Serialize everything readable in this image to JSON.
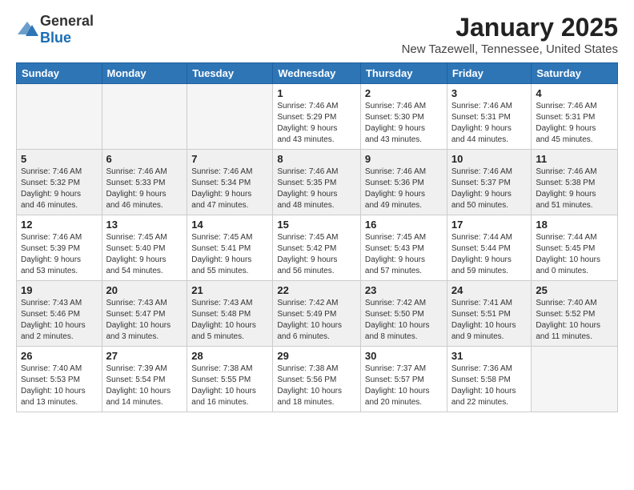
{
  "logo": {
    "general": "General",
    "blue": "Blue"
  },
  "title": "January 2025",
  "location": "New Tazewell, Tennessee, United States",
  "headers": [
    "Sunday",
    "Monday",
    "Tuesday",
    "Wednesday",
    "Thursday",
    "Friday",
    "Saturday"
  ],
  "weeks": [
    [
      {
        "day": "",
        "info": ""
      },
      {
        "day": "",
        "info": ""
      },
      {
        "day": "",
        "info": ""
      },
      {
        "day": "1",
        "info": "Sunrise: 7:46 AM\nSunset: 5:29 PM\nDaylight: 9 hours\nand 43 minutes."
      },
      {
        "day": "2",
        "info": "Sunrise: 7:46 AM\nSunset: 5:30 PM\nDaylight: 9 hours\nand 43 minutes."
      },
      {
        "day": "3",
        "info": "Sunrise: 7:46 AM\nSunset: 5:31 PM\nDaylight: 9 hours\nand 44 minutes."
      },
      {
        "day": "4",
        "info": "Sunrise: 7:46 AM\nSunset: 5:31 PM\nDaylight: 9 hours\nand 45 minutes."
      }
    ],
    [
      {
        "day": "5",
        "info": "Sunrise: 7:46 AM\nSunset: 5:32 PM\nDaylight: 9 hours\nand 46 minutes."
      },
      {
        "day": "6",
        "info": "Sunrise: 7:46 AM\nSunset: 5:33 PM\nDaylight: 9 hours\nand 46 minutes."
      },
      {
        "day": "7",
        "info": "Sunrise: 7:46 AM\nSunset: 5:34 PM\nDaylight: 9 hours\nand 47 minutes."
      },
      {
        "day": "8",
        "info": "Sunrise: 7:46 AM\nSunset: 5:35 PM\nDaylight: 9 hours\nand 48 minutes."
      },
      {
        "day": "9",
        "info": "Sunrise: 7:46 AM\nSunset: 5:36 PM\nDaylight: 9 hours\nand 49 minutes."
      },
      {
        "day": "10",
        "info": "Sunrise: 7:46 AM\nSunset: 5:37 PM\nDaylight: 9 hours\nand 50 minutes."
      },
      {
        "day": "11",
        "info": "Sunrise: 7:46 AM\nSunset: 5:38 PM\nDaylight: 9 hours\nand 51 minutes."
      }
    ],
    [
      {
        "day": "12",
        "info": "Sunrise: 7:46 AM\nSunset: 5:39 PM\nDaylight: 9 hours\nand 53 minutes."
      },
      {
        "day": "13",
        "info": "Sunrise: 7:45 AM\nSunset: 5:40 PM\nDaylight: 9 hours\nand 54 minutes."
      },
      {
        "day": "14",
        "info": "Sunrise: 7:45 AM\nSunset: 5:41 PM\nDaylight: 9 hours\nand 55 minutes."
      },
      {
        "day": "15",
        "info": "Sunrise: 7:45 AM\nSunset: 5:42 PM\nDaylight: 9 hours\nand 56 minutes."
      },
      {
        "day": "16",
        "info": "Sunrise: 7:45 AM\nSunset: 5:43 PM\nDaylight: 9 hours\nand 57 minutes."
      },
      {
        "day": "17",
        "info": "Sunrise: 7:44 AM\nSunset: 5:44 PM\nDaylight: 9 hours\nand 59 minutes."
      },
      {
        "day": "18",
        "info": "Sunrise: 7:44 AM\nSunset: 5:45 PM\nDaylight: 10 hours\nand 0 minutes."
      }
    ],
    [
      {
        "day": "19",
        "info": "Sunrise: 7:43 AM\nSunset: 5:46 PM\nDaylight: 10 hours\nand 2 minutes."
      },
      {
        "day": "20",
        "info": "Sunrise: 7:43 AM\nSunset: 5:47 PM\nDaylight: 10 hours\nand 3 minutes."
      },
      {
        "day": "21",
        "info": "Sunrise: 7:43 AM\nSunset: 5:48 PM\nDaylight: 10 hours\nand 5 minutes."
      },
      {
        "day": "22",
        "info": "Sunrise: 7:42 AM\nSunset: 5:49 PM\nDaylight: 10 hours\nand 6 minutes."
      },
      {
        "day": "23",
        "info": "Sunrise: 7:42 AM\nSunset: 5:50 PM\nDaylight: 10 hours\nand 8 minutes."
      },
      {
        "day": "24",
        "info": "Sunrise: 7:41 AM\nSunset: 5:51 PM\nDaylight: 10 hours\nand 9 minutes."
      },
      {
        "day": "25",
        "info": "Sunrise: 7:40 AM\nSunset: 5:52 PM\nDaylight: 10 hours\nand 11 minutes."
      }
    ],
    [
      {
        "day": "26",
        "info": "Sunrise: 7:40 AM\nSunset: 5:53 PM\nDaylight: 10 hours\nand 13 minutes."
      },
      {
        "day": "27",
        "info": "Sunrise: 7:39 AM\nSunset: 5:54 PM\nDaylight: 10 hours\nand 14 minutes."
      },
      {
        "day": "28",
        "info": "Sunrise: 7:38 AM\nSunset: 5:55 PM\nDaylight: 10 hours\nand 16 minutes."
      },
      {
        "day": "29",
        "info": "Sunrise: 7:38 AM\nSunset: 5:56 PM\nDaylight: 10 hours\nand 18 minutes."
      },
      {
        "day": "30",
        "info": "Sunrise: 7:37 AM\nSunset: 5:57 PM\nDaylight: 10 hours\nand 20 minutes."
      },
      {
        "day": "31",
        "info": "Sunrise: 7:36 AM\nSunset: 5:58 PM\nDaylight: 10 hours\nand 22 minutes."
      },
      {
        "day": "",
        "info": ""
      }
    ]
  ]
}
